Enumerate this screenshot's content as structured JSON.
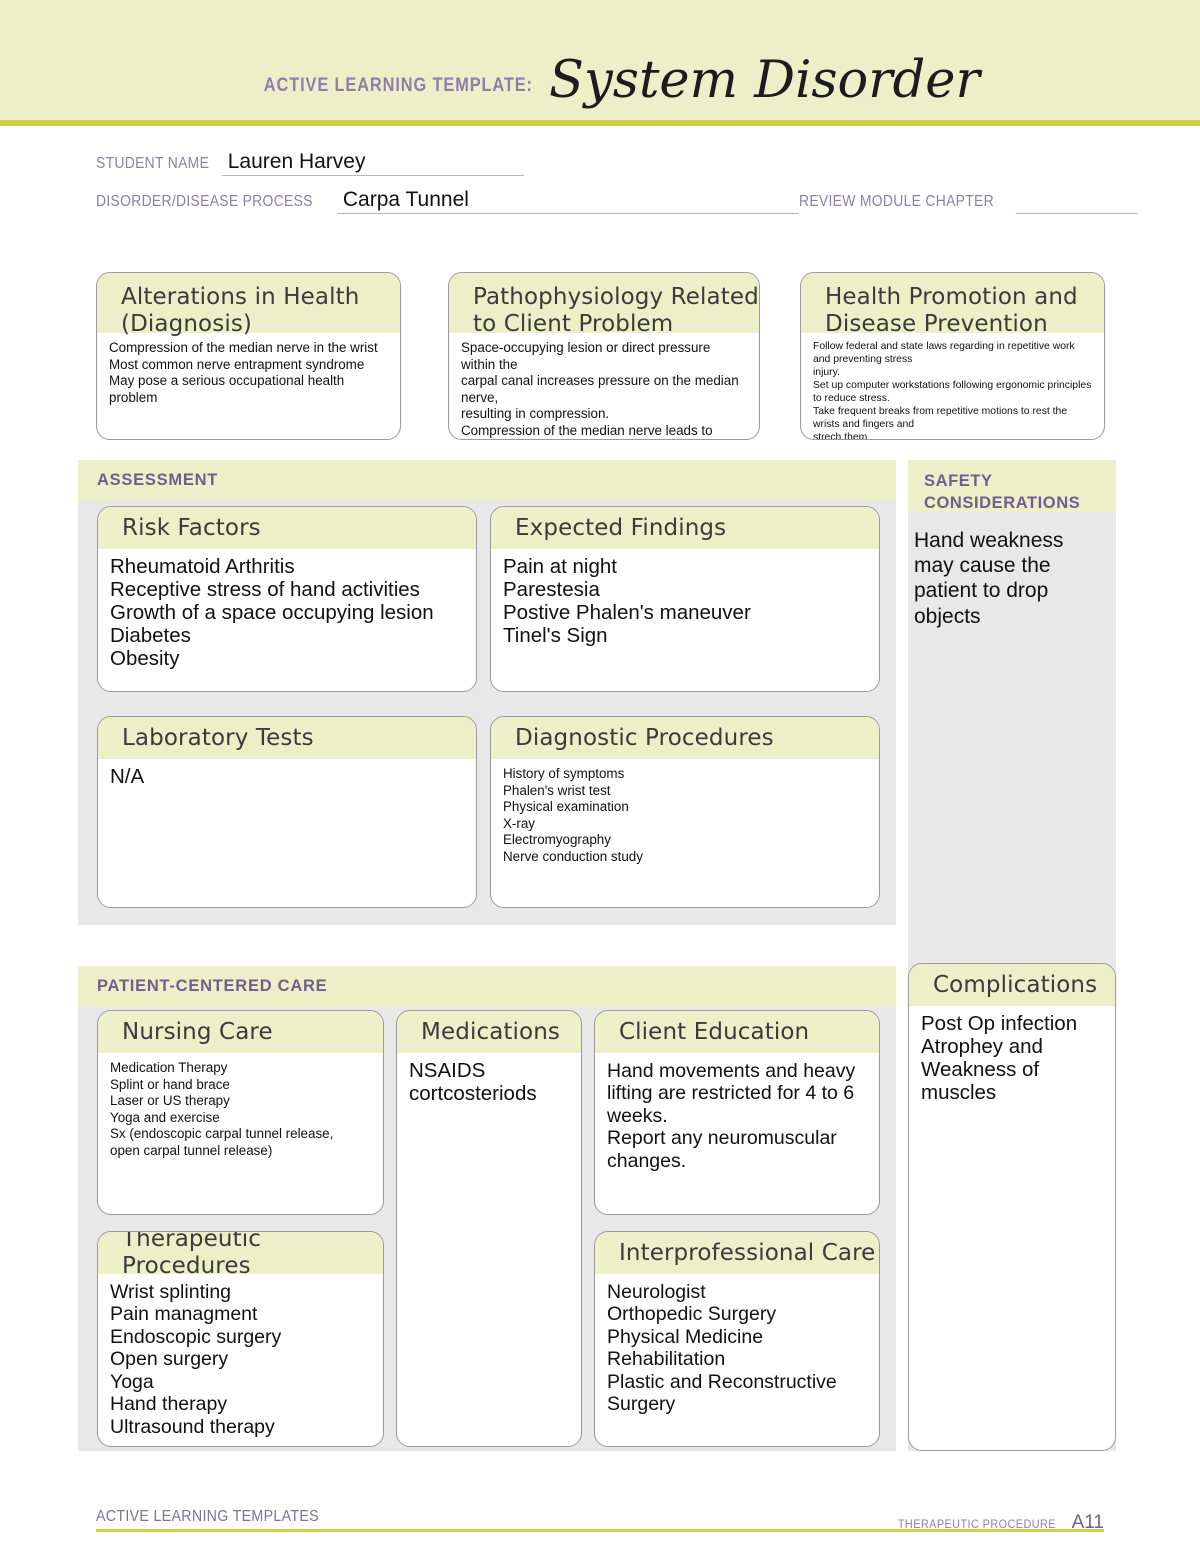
{
  "header": {
    "eyebrow": "ACTIVE LEARNING TEMPLATE:",
    "title": "System Disorder",
    "band_color": "#ecefc8",
    "rule_color": "#cdd13f",
    "eyebrow_color": "#8c7fa8"
  },
  "fields": {
    "student_name_label": "STUDENT NAME",
    "student_name_value": "Lauren Harvey",
    "disorder_label": "DISORDER/DISEASE PROCESS",
    "disorder_value": "Carpa Tunnel",
    "chapter_label": "REVIEW MODULE CHAPTER",
    "chapter_value": ""
  },
  "top_cards": [
    {
      "title": "Alterations in\nHealth (Diagnosis)",
      "body": "Compression of the median nerve in the wrist\nMost common nerve entrapment syndrome\nMay pose a serious occupational health problem"
    },
    {
      "title": "Pathophysiology Related\nto Client Problem",
      "body": "Space-occupying lesion or direct pressure within the\ncarpal canal increases pressure on the median nerve,\nresulting in compression.\nCompression of the median nerve leads to demyelination\nand subsequent axonal degeneration, which interrupts\nnormal function."
    },
    {
      "title": "Health Promotion and\nDisease Prevention",
      "body": "Follow federal and state laws regarding in repetitive work and preventing stress\ninjury.\nSet up computer workstations following ergonomic principles to reduce stress.\nTake frequent breaks from repetitive motions to rest the wrists and fingers and\nstrech them"
    }
  ],
  "assessment": {
    "banner": "ASSESSMENT",
    "cards": [
      {
        "title": "Risk Factors",
        "body": "Rheumatoid Arthritis\nReceptive stress of hand activities\nGrowth of a space occupying lesion\nDiabetes\nObesity"
      },
      {
        "title": "Expected Findings",
        "body": "Pain at night\nParestesia\nPostive Phalen's maneuver\nTinel's Sign"
      },
      {
        "title": "Laboratory Tests",
        "body": "N/A"
      },
      {
        "title": "Diagnostic Procedures",
        "body": "History of symptoms\nPhalen's wrist test\nPhysical examination\nX-ray\nElectromyography\nNerve conduction study"
      }
    ]
  },
  "safety": {
    "banner": "SAFETY\nCONSIDERATIONS",
    "body": "Hand weakness\nmay cause the\npatient to drop\nobjects"
  },
  "patient_centered_care": {
    "banner": "PATIENT-CENTERED CARE",
    "cards": [
      {
        "title": "Nursing Care",
        "body": "Medication Therapy\nSplint or hand brace\nLaser or US therapy\nYoga and exercise\nSx (endoscopic carpal tunnel release,\nopen carpal tunnel release)"
      },
      {
        "title": "Medications",
        "body": "NSAIDS\ncortcosteriods"
      },
      {
        "title": "Client Education",
        "body": "Hand movements and heavy\nlifting are restricted for 4 to 6\nweeks.\nReport any neuromuscular\nchanges."
      },
      {
        "title": "Therapeutic Procedures",
        "body": "Wrist splinting\nPain managment\nEndoscopic surgery\nOpen surgery\nYoga\nHand therapy\nUltrasound therapy"
      },
      {
        "title": "Interprofessional Care",
        "body": "Neurologist\nOrthopedic Surgery\nPhysical Medicine\nRehabilitation\nPlastic and Reconstructive\nSurgery"
      }
    ]
  },
  "complications": {
    "title": "Complications",
    "body": "Post Op infection\nAtrophey and\nWeakness of\nmuscles"
  },
  "footer": {
    "left": "ACTIVE LEARNING TEMPLATES",
    "category": "THERAPEUTIC PROCEDURE",
    "page": "A11"
  }
}
